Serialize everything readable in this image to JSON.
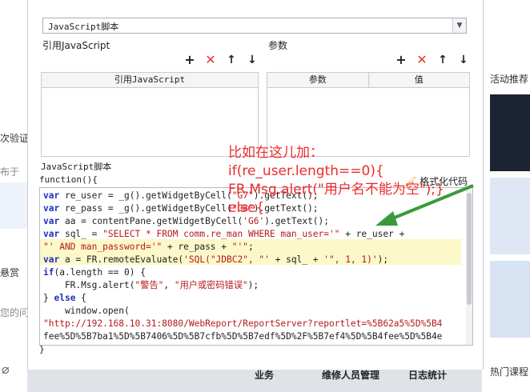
{
  "background_left": {
    "fragments": [
      "次验证",
      "布于",
      "悬赏",
      "您的问"
    ]
  },
  "background_right": {
    "labels": [
      "活动推荐",
      "热门课程"
    ]
  },
  "dialog": {
    "script_type_select": {
      "value": "JavaScript脚本"
    },
    "references": {
      "label": "引用JavaScript",
      "column_header": "引用JavaScript"
    },
    "parameters": {
      "label": "参数",
      "columns": [
        "参数",
        "值"
      ]
    },
    "toolbar": {
      "add": "+",
      "delete": "✕",
      "up": "↑",
      "down": "↓"
    },
    "script_section_label": "JavaScript脚本",
    "function_signature": "function(){",
    "format_button_label": "格式化代码",
    "closing_brace": "}",
    "code_lines": [
      "var re_user = _g().getWidgetByCell(\"G7\").getText();",
      "var re_pass = _g().getWidgetByCell(\"G8\").getText();",
      "var aa = contentPane.getWidgetByCell('G6').getText();",
      "var sql_ = \"SELECT * FROM comm.re_man WHERE man_user='\" + re_user +",
      "\"' AND man_password='\" + re_pass + \"'\";",
      "var a = FR.remoteEvaluate('SQL(\"JDBC2\", \"' + sql_ + '\", 1, 1)');",
      "if(a.length == 0) {",
      "    FR.Msg.alert(\"警告\", \"用户或密码错误\");",
      "} else {",
      "    window.open(",
      "\"http://192.168.10.31:8080/WebReport/ReportServer?reportlet=%5B62a5%5D%5B4",
      "fee%5D%5B7ba1%5D%5B7406%5D%5B7cfb%5D%5B7edf%5D%2F%5B7ef4%5D%5B4fee%5D%5B4e"
    ],
    "bottom_buttons": [
      "业务",
      "维修人员管理",
      "日志统计"
    ]
  },
  "annotation": {
    "lines": [
      "比如在这儿加：",
      "if(re_user.length==0){",
      "FR.Msg.alert(\"用户名不能为空\");}",
      "else{"
    ],
    "color": "#ee2b2b"
  },
  "colors": {
    "keyword": "#1f2fbf",
    "string": "#b51a1a",
    "highlight": "#fcf8c9",
    "arrow": "#3a9a3a"
  }
}
